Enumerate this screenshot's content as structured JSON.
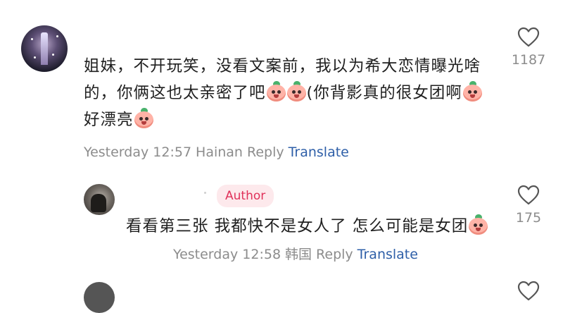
{
  "comments": [
    {
      "segments": [
        {
          "type": "text",
          "value": "姐妹，不开玩笑，没看文案前，我以为希大恋情曝光啥的，你俩这也太亲密了吧"
        },
        {
          "type": "emoji",
          "name": "peach-scream-emoji"
        },
        {
          "type": "emoji",
          "name": "peach-scream-emoji"
        },
        {
          "type": "text",
          "value": "(你背影真的很女团啊"
        },
        {
          "type": "emoji",
          "name": "peach-drool-emoji"
        },
        {
          "type": "text",
          "value": "好漂亮"
        },
        {
          "type": "emoji",
          "name": "peach-shocked-emoji"
        }
      ],
      "time": "Yesterday 12:57",
      "location": "Hainan",
      "reply_label": "Reply",
      "translate_label": "Translate",
      "likes": "1187"
    },
    {
      "author_badge": "Author",
      "text_before_emoji": "看看第三张 我都快不是女人了 怎么可能是女团",
      "emoji": "peach-crying-laugh-emoji",
      "time": "Yesterday 12:58",
      "location": "韩国",
      "reply_label": "Reply",
      "translate_label": "Translate",
      "likes": "175"
    }
  ],
  "colors": {
    "text": "#1f1f1f",
    "meta": "#8c8c8c",
    "translate": "#2e5fa8",
    "author_badge_bg": "#fde9ec",
    "author_badge_text": "#e0315a"
  }
}
